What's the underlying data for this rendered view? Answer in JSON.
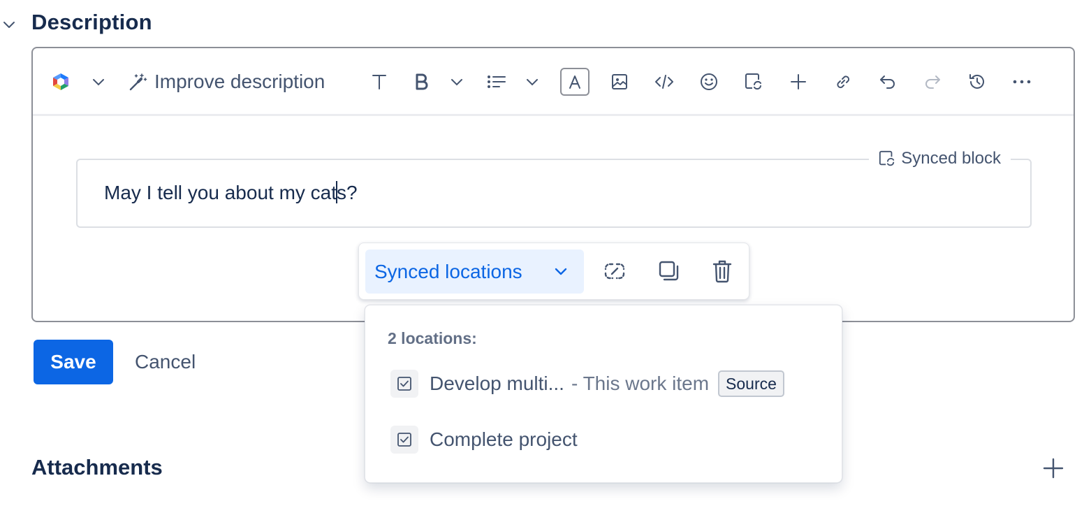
{
  "description": {
    "title": "Description",
    "collapse_icon": "chevron-down-icon"
  },
  "toolbar": {
    "improve_label": "Improve description",
    "icons": [
      "ai-logo-icon",
      "chevron-down-icon",
      "magic-wand-icon",
      "text-style-icon",
      "bold-icon",
      "chevron-down-icon",
      "bullet-list-icon",
      "chevron-down-icon",
      "text-color-icon",
      "image-icon",
      "code-icon",
      "emoji-icon",
      "synced-block-icon",
      "plus-icon",
      "link-icon",
      "undo-icon",
      "redo-icon",
      "history-icon",
      "more-icon"
    ],
    "ai_logo_colors": [
      "#1d7afc",
      "#8f7ee7",
      "#f5cd47",
      "#e2483d",
      "#22a06b"
    ]
  },
  "synced_block": {
    "label": "Synced block",
    "text": "May I tell you about my cats?",
    "text_before_cursor": "May I tell you about my cat",
    "text_after_cursor": "s?"
  },
  "floating_toolbar": {
    "synced_locations_label": "Synced locations",
    "icons": [
      "unsync-icon",
      "copy-icon",
      "delete-icon"
    ]
  },
  "dropdown": {
    "heading": "2 locations:",
    "items": [
      {
        "title": "Develop multi...",
        "subtitle": "- This work item",
        "badge": "Source",
        "icon": "checkbox-task-icon"
      },
      {
        "title": "Complete project",
        "icon": "checkbox-task-icon"
      }
    ]
  },
  "actions": {
    "save_label": "Save",
    "cancel_label": "Cancel"
  },
  "attachments": {
    "title": "Attachments",
    "add_icon": "plus-icon"
  },
  "colors": {
    "primary": "#0c66e4",
    "primary_subtle": "#e9f2ff",
    "text": "#172b4d",
    "text_subtle": "#44546f"
  }
}
